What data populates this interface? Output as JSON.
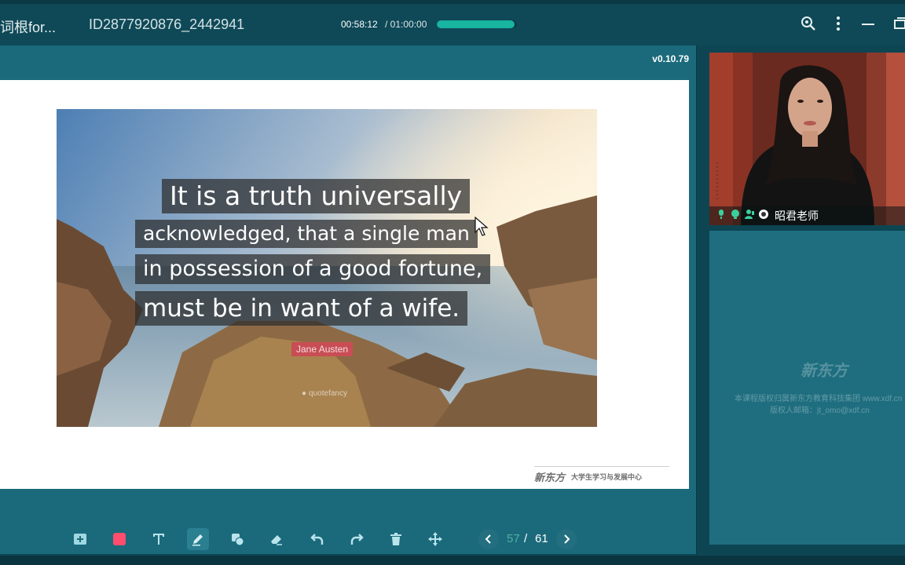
{
  "topbar": {
    "course_title": "词根for...",
    "session_id": "ID2877920876_2442941",
    "time_elapsed": "00:58:12",
    "time_total": "/ 01:00:00",
    "progress": 0.97,
    "icons": [
      "search-settings-icon",
      "more-icon",
      "minimize-icon",
      "restore-icon"
    ]
  },
  "slide_panel": {
    "version": "v0.10.79",
    "quote_lines": [
      "It is a truth universally",
      "acknowledged, that a single man",
      "in possession of a good fortune,",
      "must be in want of a wife."
    ],
    "author": "Jane Austen",
    "watermark": "quotefancy",
    "footer_logo": "新东方",
    "footer_text": "大学生学习与发展中心"
  },
  "toolbar": {
    "tools": [
      "add-page-icon",
      "color-icon",
      "text-icon",
      "pen-icon",
      "shape-icon",
      "eraser-icon",
      "undo-icon",
      "redo-icon",
      "delete-icon",
      "move-icon"
    ],
    "active_tool": "pen-icon",
    "accent": "#ff4d6d",
    "page_current": "57",
    "page_sep": "/",
    "page_total": "61"
  },
  "video": {
    "teacher_name": "昭君老师"
  },
  "side_panel": {
    "logo": "新东方",
    "copyright_line1": "本课程版权归属新东方教育科技集团 www.xdf.cn",
    "copyright_line2": "版权人邮箱：jt_omo@xdf.cn"
  }
}
